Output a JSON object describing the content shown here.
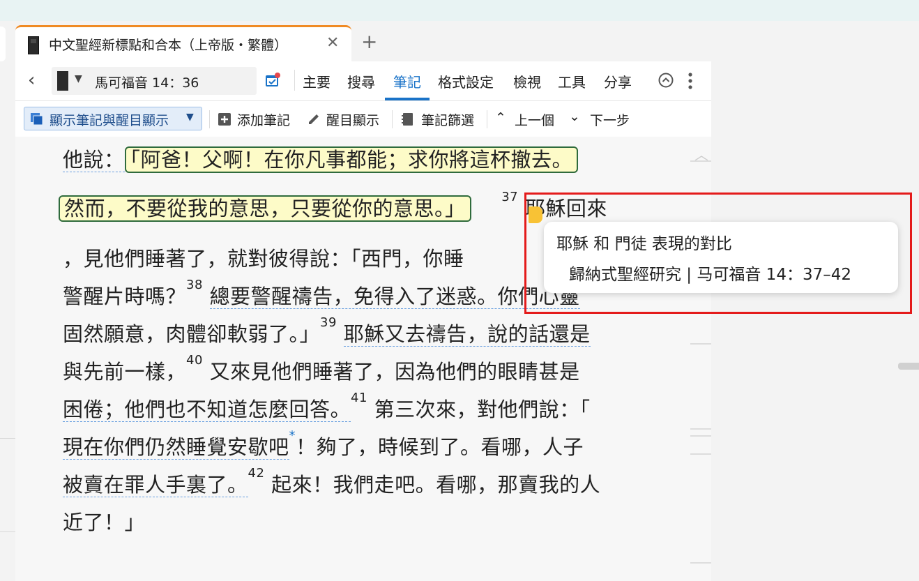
{
  "tab": {
    "title": "中文聖經新標點和合本（上帝版・繁體）",
    "close": "✕",
    "new_tab": "+"
  },
  "nav": {
    "reference": "馬可福音 14：36"
  },
  "menu": {
    "items": [
      "主要",
      "搜尋",
      "筆記",
      "格式設定",
      "檢視",
      "工具",
      "分享"
    ],
    "active": "筆記"
  },
  "notes_toolbar": {
    "show_dropdown": "顯示筆記與醒目顯示",
    "add_note": "添加筆記",
    "highlight": "醒目顯示",
    "filter": "筆記篩選",
    "previous": "上一個",
    "next": "下一步"
  },
  "text": {
    "l1a": "他說：",
    "l1b": "「阿爸！父啊！在你凡事都能；求你將這杯撤去。",
    "l2a": "然而，不要從我的意思，只要從你的意思。」",
    "v37": "37",
    "l2b": "耶穌回來",
    "l3": "，見他們睡著了，就對彼得說：「西門，你睡",
    "l4a": "警醒片時嗎？",
    "v38": "38",
    "l4b": "總要警醒禱告，免得入了迷惑。你們心靈",
    "l5a": "固然願意，肉體卻軟弱了。」",
    "v39": "39",
    "l5b": "耶穌又去禱告，說的話還是",
    "l6a": "與先前一樣，",
    "v40": "40",
    "l6b": "又來見他們睡著了，因為他們的眼睛甚是",
    "l7a": "困倦；他們也不知道怎麼回答。",
    "v41": "41",
    "l7b": "第三次來，對他們說：「",
    "l8a": "現在你們仍然睡覺安歇吧",
    "l8star": "*",
    "l8b": "！夠了，時候到了。看哪，人子",
    "l9a": "被賣在罪人手裏了。",
    "v42": "42",
    "l9b": "起來！我們走吧。看哪，那賣我的人",
    "l10": "近了！」"
  },
  "note_popup": {
    "title": "耶穌 和 門徒 表現的對比",
    "source": "歸納式聖經研究 | 马可福音 14：37–42"
  },
  "colors": {
    "accent": "#1a73c8",
    "tab_accent": "#f08a24",
    "highlight_fill": "#fdfbc8",
    "highlight_border": "#2f6b3d",
    "red_box": "#e41b1b"
  }
}
